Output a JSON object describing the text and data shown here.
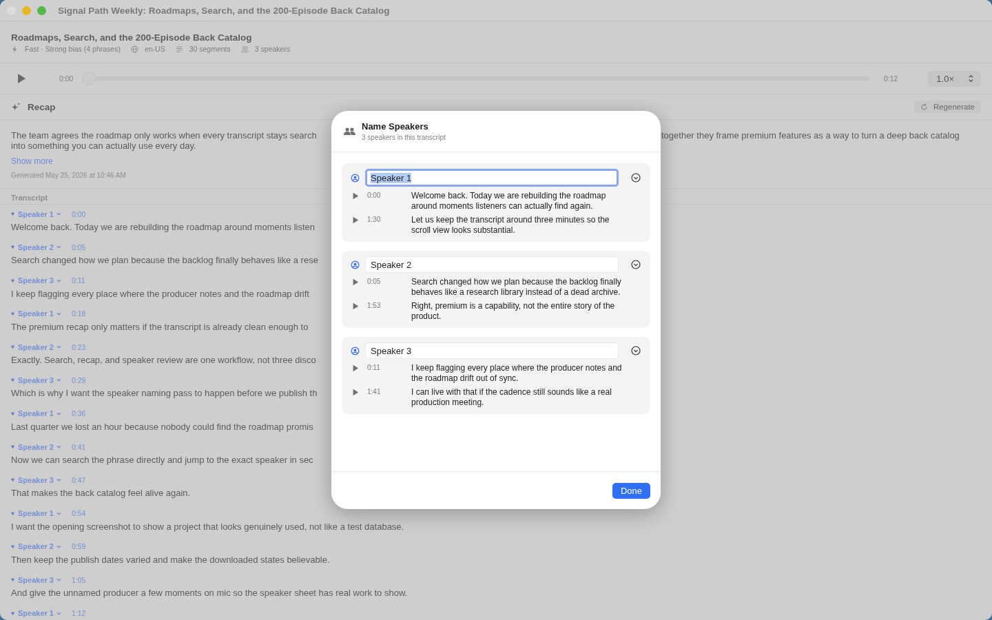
{
  "window": {
    "title": "Signal Path Weekly: Roadmaps, Search, and the 200-Episode Back Catalog"
  },
  "episode": {
    "title": "Roadmaps, Search, and the 200-Episode Back Catalog",
    "meta": [
      {
        "kind": "mode",
        "text": "Fast · Strong bias (4 phrases)"
      },
      {
        "kind": "language",
        "text": "en-US"
      },
      {
        "kind": "segments",
        "text": "30 segments"
      },
      {
        "kind": "speakers",
        "text": "3 speakers"
      }
    ]
  },
  "player": {
    "elapsed": "0:00",
    "duration": "0:12",
    "level": 0,
    "speed": "1.0×"
  },
  "recap": {
    "title": "Recap",
    "regenerate": "Regenerate",
    "line_1_left": "The team agrees the roadmap only works when every transcript stays search",
    "line_1_right": "together they frame premium features as a way to turn a deep back catalog",
    "line_2": "into something you can actually use every day.",
    "show_more": "Show more",
    "generated": "Generated May 25, 2026 at 10:46 AM"
  },
  "transcript": {
    "title": "Transcript",
    "segments": [
      {
        "speaker": "Speaker 1",
        "time": "0:00",
        "text": "Welcome back. Today we are rebuilding the roadmap around moments listen"
      },
      {
        "speaker": "Speaker 2",
        "time": "0:05",
        "text": "Search changed how we plan because the backlog finally behaves like a rese"
      },
      {
        "speaker": "Speaker 3",
        "time": "0:11",
        "text": "I keep flagging every place where the producer notes and the roadmap drift"
      },
      {
        "speaker": "Speaker 1",
        "time": "0:18",
        "text": "The premium recap only matters if the transcript is already clean enough to"
      },
      {
        "speaker": "Speaker 2",
        "time": "0:23",
        "text": "Exactly. Search, recap, and speaker review are one workflow, not three disco"
      },
      {
        "speaker": "Speaker 3",
        "time": "0:29",
        "text": "Which is why I want the speaker naming pass to happen before we publish th"
      },
      {
        "speaker": "Speaker 1",
        "time": "0:36",
        "text": "Last quarter we lost an hour because nobody could find the roadmap promis"
      },
      {
        "speaker": "Speaker 2",
        "time": "0:41",
        "text": "Now we can search the phrase directly and jump to the exact speaker in sec"
      },
      {
        "speaker": "Speaker 3",
        "time": "0:47",
        "text": "That makes the back catalog feel alive again."
      },
      {
        "speaker": "Speaker 1",
        "time": "0:54",
        "text": "I want the opening screenshot to show a project that looks genuinely used, not like a test database."
      },
      {
        "speaker": "Speaker 2",
        "time": "0:59",
        "text": "Then keep the publish dates varied and make the downloaded states believable."
      },
      {
        "speaker": "Speaker 3",
        "time": "1:05",
        "text": "And give the unnamed producer a few moments on mic so the speaker sheet has real work to show."
      },
      {
        "speaker": "Speaker 1",
        "time": "1:12"
      }
    ]
  },
  "dialog": {
    "title": "Name Speakers",
    "subtitle": "3 speakers in this transcript",
    "speakers": [
      {
        "name": "Speaker 1",
        "focused": true,
        "segments": [
          {
            "time": "0:00",
            "text": "Welcome back. Today we are rebuilding the roadmap around moments listeners can actually find again."
          },
          {
            "time": "1:30",
            "text": "Let us keep the transcript around three minutes so the scroll view looks substantial."
          }
        ]
      },
      {
        "name": "Speaker 2",
        "focused": false,
        "segments": [
          {
            "time": "0:05",
            "text": "Search changed how we plan because the backlog finally behaves like a research library instead of a dead archive."
          },
          {
            "time": "1:53",
            "text": "Right, premium is a capability, not the entire story of the product."
          }
        ]
      },
      {
        "name": "Speaker 3",
        "focused": false,
        "segments": [
          {
            "time": "0:11",
            "text": "I keep flagging every place where the producer notes and the roadmap drift out of sync."
          },
          {
            "time": "1:41",
            "text": "I can live with that if the cadence still sounds like a real production meeting."
          }
        ]
      }
    ],
    "done": "Done"
  }
}
